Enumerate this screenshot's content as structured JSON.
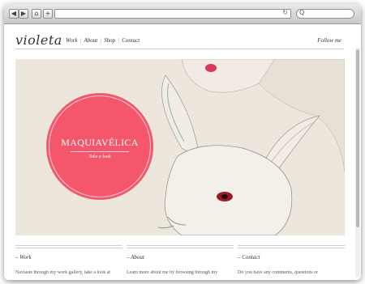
{
  "browser": {
    "back": "◀",
    "forward": "▶",
    "home": "⌂",
    "add": "+",
    "reload_icon": "↻",
    "search_icon": "Q"
  },
  "site": {
    "logo": "violeta",
    "nav": [
      "Work",
      "About",
      "Shop",
      "Contact"
    ],
    "follow": "Follow me"
  },
  "hero": {
    "title": "MAQUIAVÉLICA",
    "subtitle": "Take a look"
  },
  "colors": {
    "accent": "#f4566c",
    "hero_bg": "#ece6dd"
  },
  "sections": [
    {
      "title": "– Work",
      "text": "Naviaste through my work gallery, take a look at"
    },
    {
      "title": "– About",
      "text": "Learn more about me by browsing through my"
    },
    {
      "title": "– Contact",
      "text": "Do you have any comments, questions or"
    }
  ]
}
